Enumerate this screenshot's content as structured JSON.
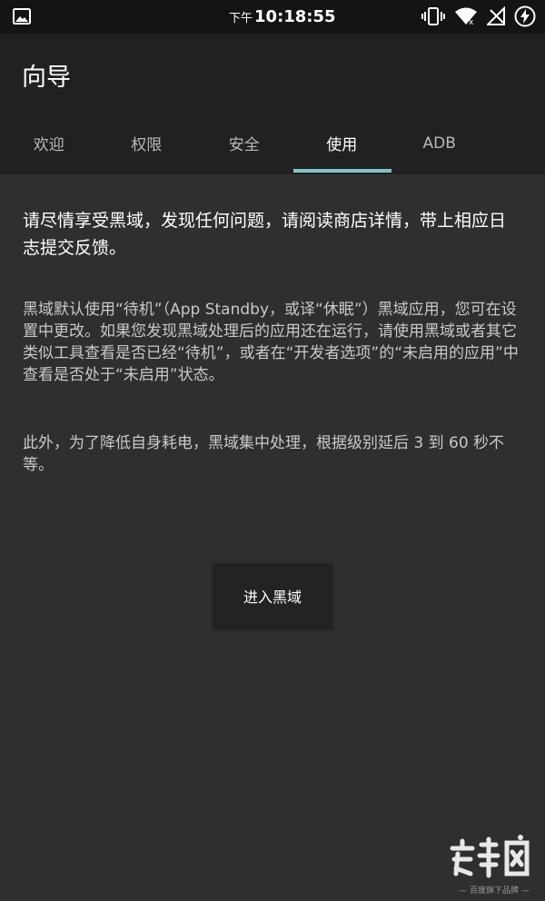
{
  "status_bar": {
    "time_prefix": "下午",
    "time": "10:18:55",
    "icons": [
      "image-icon",
      "vibrate-icon",
      "wifi-icon",
      "no-signal-icon",
      "battery-charging-icon"
    ]
  },
  "app_bar": {
    "title": "向导"
  },
  "tabs": [
    {
      "label": "欢迎"
    },
    {
      "label": "权限"
    },
    {
      "label": "安全"
    },
    {
      "label": "使用",
      "active": true
    },
    {
      "label": "ADB"
    }
  ],
  "content": {
    "lead": "请尽情享受黑域，发现任何问题，请阅读商店详情，带上相应日志提交反馈。",
    "paragraph1": "黑域默认使用“待机”（App Standby，或译“休眠”）黑域应用，您可在设置中更改。如果您发现黑域处理后的应用还在运行，请使用黑域或者其它类似工具查看是否已经“待机”，或者在“开发者选项”的“未启用的应用”中查看是否处于“未启用”状态。",
    "paragraph2": "此外，为了降低自身耗电，黑域集中处理，根据级别延后 3 到 60 秒不等。",
    "enter_button": "进入黑域"
  },
  "watermark": {
    "text": "— 百度旗下品牌 —"
  },
  "colors": {
    "background": "#2f2f2f",
    "app_bar": "#212121",
    "status_bar": "#141414",
    "tab_indicator": "#7fc4c9",
    "button": "#232323"
  }
}
